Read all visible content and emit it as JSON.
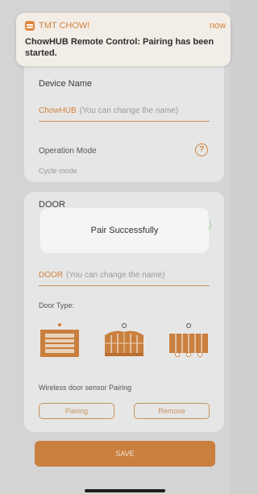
{
  "notification": {
    "app_name": "TMT CHOW!",
    "time": "now",
    "message": "ChowHUB Remote Control: Pairing has been started."
  },
  "device_section": {
    "title": "Device Name",
    "name_value": "ChowHUB",
    "name_placeholder": "(You can change the name)",
    "operation_mode_label": "Operation Mode",
    "operation_mode_value": "Cycle mode",
    "help_symbol": "?"
  },
  "door_section": {
    "title": "DOOR",
    "name_value": "DOOR",
    "name_placeholder": "(You can change the name)",
    "door_type_label": "Door Type:",
    "door_types": [
      {
        "icon": "garage-door-icon",
        "selected": true
      },
      {
        "icon": "arched-gate-icon",
        "selected": false
      },
      {
        "icon": "sliding-gate-icon",
        "selected": false
      }
    ],
    "enable_toggle_on": true,
    "sensor_pairing_label": "Wireless door sensor Pairing",
    "pairing_button": "Pairing",
    "remove_button": "Remove"
  },
  "toast": {
    "message": "Pair Successfully"
  },
  "save_button": "SAVE",
  "colors": {
    "accent": "#d0823c",
    "save_button_bg": "#c9803f",
    "toggle_on": "#bcd9b8"
  }
}
